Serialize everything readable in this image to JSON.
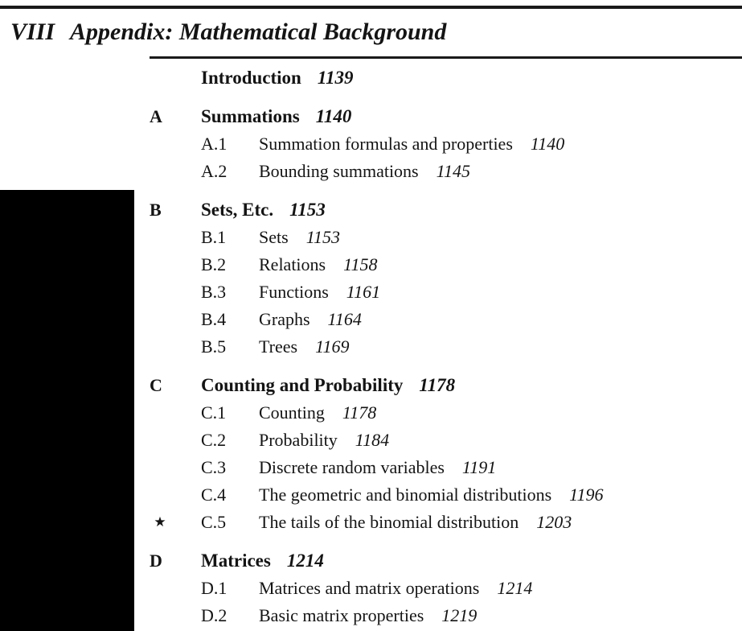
{
  "part": {
    "number": "VIII",
    "title": "Appendix: Mathematical Background"
  },
  "colors": {
    "text": "#141414",
    "rule": "#1a1a1a",
    "background": "#ffffff",
    "bleed_bar": "#000000"
  },
  "marks": {
    "starred": "★"
  },
  "entries": [
    {
      "kind": "intro",
      "letter": "",
      "label": "",
      "title": "Introduction",
      "page": "1139",
      "mark": ""
    },
    {
      "kind": "chapter",
      "letter": "A",
      "label": "",
      "title": "Summations",
      "page": "1140",
      "mark": ""
    },
    {
      "kind": "section",
      "letter": "",
      "label": "A.1",
      "title": "Summation formulas and properties",
      "page": "1140",
      "mark": ""
    },
    {
      "kind": "section",
      "letter": "",
      "label": "A.2",
      "title": "Bounding summations",
      "page": "1145",
      "mark": ""
    },
    {
      "kind": "chapter",
      "letter": "B",
      "label": "",
      "title": "Sets, Etc.",
      "page": "1153",
      "mark": ""
    },
    {
      "kind": "section",
      "letter": "",
      "label": "B.1",
      "title": "Sets",
      "page": "1153",
      "mark": ""
    },
    {
      "kind": "section",
      "letter": "",
      "label": "B.2",
      "title": "Relations",
      "page": "1158",
      "mark": ""
    },
    {
      "kind": "section",
      "letter": "",
      "label": "B.3",
      "title": "Functions",
      "page": "1161",
      "mark": ""
    },
    {
      "kind": "section",
      "letter": "",
      "label": "B.4",
      "title": "Graphs",
      "page": "1164",
      "mark": ""
    },
    {
      "kind": "section",
      "letter": "",
      "label": "B.5",
      "title": "Trees",
      "page": "1169",
      "mark": ""
    },
    {
      "kind": "chapter",
      "letter": "C",
      "label": "",
      "title": "Counting and Probability",
      "page": "1178",
      "mark": ""
    },
    {
      "kind": "section",
      "letter": "",
      "label": "C.1",
      "title": "Counting",
      "page": "1178",
      "mark": ""
    },
    {
      "kind": "section",
      "letter": "",
      "label": "C.2",
      "title": "Probability",
      "page": "1184",
      "mark": ""
    },
    {
      "kind": "section",
      "letter": "",
      "label": "C.3",
      "title": "Discrete random variables",
      "page": "1191",
      "mark": ""
    },
    {
      "kind": "section",
      "letter": "",
      "label": "C.4",
      "title": "The geometric and binomial distributions",
      "page": "1196",
      "mark": ""
    },
    {
      "kind": "section",
      "letter": "",
      "label": "C.5",
      "title": "The tails of the binomial distribution",
      "page": "1203",
      "mark": "★"
    },
    {
      "kind": "chapter",
      "letter": "D",
      "label": "",
      "title": "Matrices",
      "page": "1214",
      "mark": ""
    },
    {
      "kind": "section",
      "letter": "",
      "label": "D.1",
      "title": "Matrices and matrix operations",
      "page": "1214",
      "mark": ""
    },
    {
      "kind": "section",
      "letter": "",
      "label": "D.2",
      "title": "Basic matrix properties",
      "page": "1219",
      "mark": ""
    }
  ]
}
